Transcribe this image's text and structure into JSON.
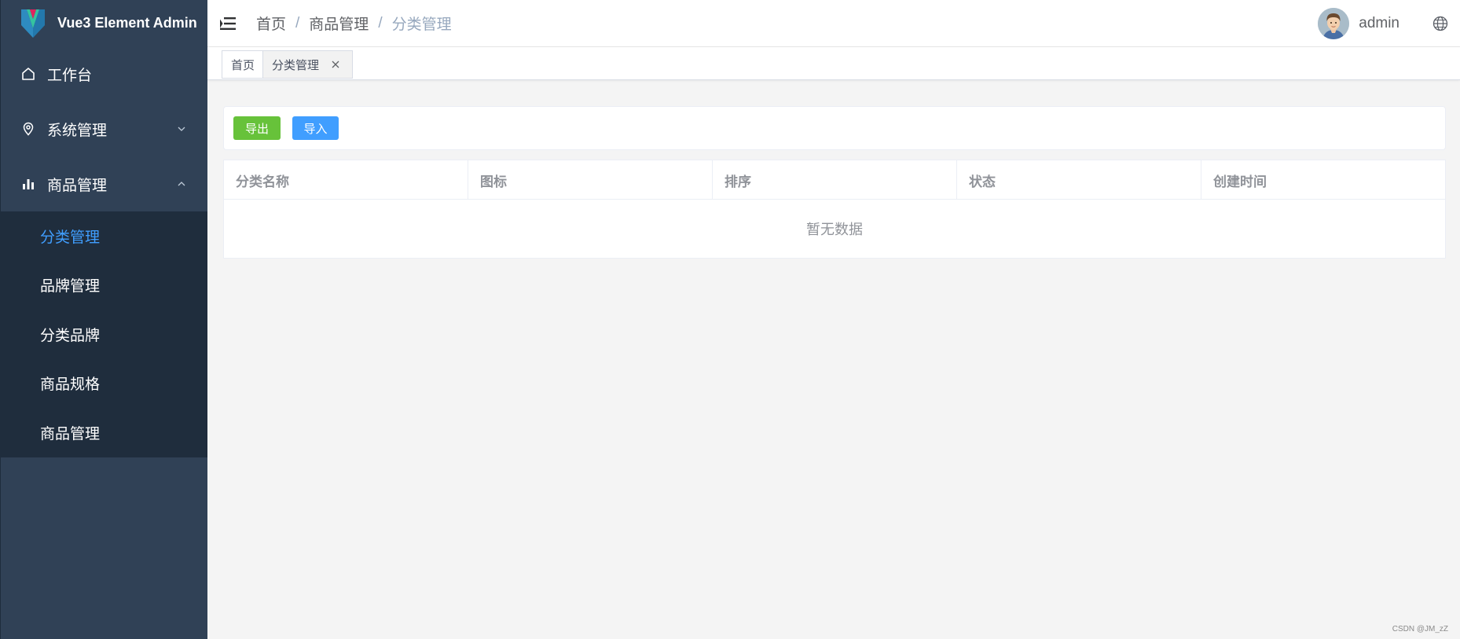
{
  "app": {
    "title": "Vue3 Element Admin"
  },
  "sidebar": {
    "items": [
      {
        "label": "工作台",
        "icon": "home-icon"
      },
      {
        "label": "系统管理",
        "icon": "location-icon",
        "expanded": false
      },
      {
        "label": "商品管理",
        "icon": "bar-chart-icon",
        "expanded": true
      }
    ],
    "submenu": [
      {
        "label": "分类管理",
        "active": true
      },
      {
        "label": "品牌管理",
        "active": false
      },
      {
        "label": "分类品牌",
        "active": false
      },
      {
        "label": "商品规格",
        "active": false
      },
      {
        "label": "商品管理",
        "active": false
      }
    ]
  },
  "navbar": {
    "breadcrumb": [
      "首页",
      "商品管理",
      "分类管理"
    ],
    "separator": "/",
    "username": "admin"
  },
  "tags": [
    {
      "label": "首页",
      "active": false,
      "closable": false
    },
    {
      "label": "分类管理",
      "active": true,
      "closable": true
    }
  ],
  "toolbar": {
    "export_label": "导出",
    "import_label": "导入"
  },
  "table": {
    "columns": [
      "分类名称",
      "图标",
      "排序",
      "状态",
      "创建时间"
    ],
    "rows": [],
    "empty_text": "暂无数据"
  },
  "watermark": "CSDN @JM_zZ",
  "colors": {
    "sidebar_bg": "#304156",
    "submenu_bg": "#1f2d3d",
    "active_menu": "#409eff",
    "export_button": "#67c23a",
    "import_button": "#409eff"
  }
}
